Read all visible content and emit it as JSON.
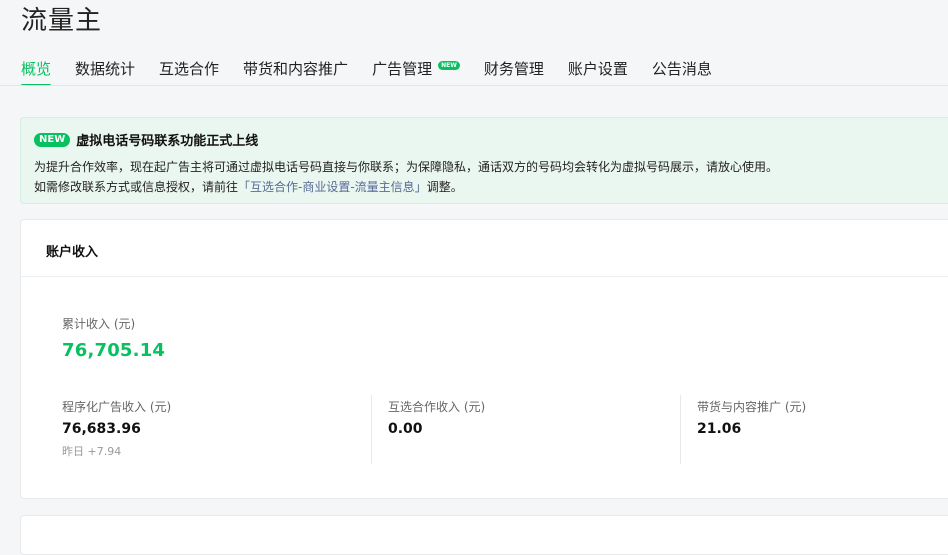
{
  "app": {
    "title": "流量主"
  },
  "tabs": [
    {
      "label": "概览",
      "active": true
    },
    {
      "label": "数据统计"
    },
    {
      "label": "互选合作"
    },
    {
      "label": "带货和内容推广"
    },
    {
      "label": "广告管理",
      "badge": "NEW"
    },
    {
      "label": "财务管理"
    },
    {
      "label": "账户设置"
    },
    {
      "label": "公告消息"
    }
  ],
  "notice": {
    "badge": "NEW",
    "title": "虚拟电话号码联系功能正式上线",
    "line1": "为提升合作效率，现在起广告主将可通过虚拟电话号码直接与你联系；为保障隐私，通话双方的号码均会转化为虚拟号码展示，请放心使用。",
    "line2_prefix": "如需修改联系方式或信息授权，请前往",
    "line2_link": "「互选合作-商业设置-流量主信息」",
    "line2_suffix": "调整。"
  },
  "income": {
    "title": "账户收入",
    "total_label": "累计收入 (元)",
    "total_value": "76,705.14",
    "stats": [
      {
        "label": "程序化广告收入 (元)",
        "value": "76,683.96",
        "sub": "昨日 +7.94"
      },
      {
        "label": "互选合作收入 (元)",
        "value": "0.00"
      },
      {
        "label": "带货与内容推广 (元)",
        "value": "21.06"
      }
    ]
  },
  "colors": {
    "accent": "#07c160",
    "link": "#576b95",
    "notice_bg": "#eaf6f0"
  }
}
